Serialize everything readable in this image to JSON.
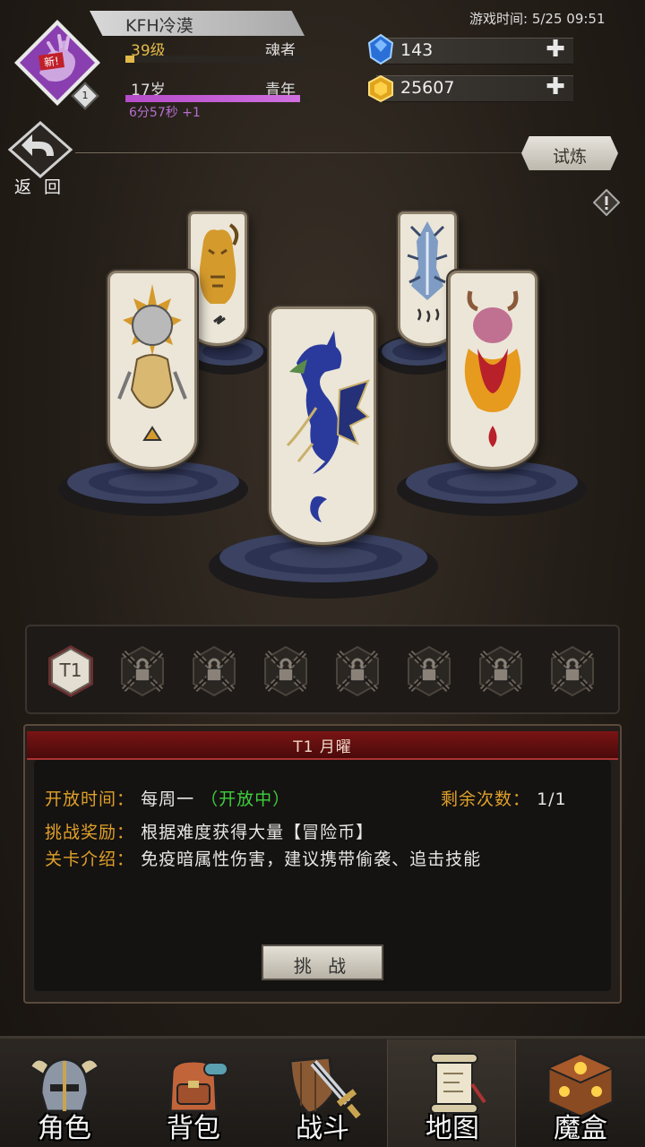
{
  "status": {
    "game_time": "游戏时间: 5/25 09:51"
  },
  "player": {
    "new_tag": "新!",
    "vip_level": "1",
    "name": "KFH冷漠",
    "level": "39级",
    "title": "魂者",
    "level_progress": 0.05,
    "age": "17岁",
    "stage": "青年",
    "age_progress": 0.95,
    "timer": "6分57秒 +1",
    "emblem_color": "#8a3fb0"
  },
  "currency": {
    "gems": "143",
    "gold": "25607",
    "gem_icon": "blue-crystal-icon",
    "gold_icon": "gold-coin-icon"
  },
  "nav_top": {
    "back_label": "返 回",
    "trial_label": "试炼"
  },
  "banners": [
    {
      "name": "spiked-beast",
      "symbol": "triangle"
    },
    {
      "name": "lynx",
      "symbol": "lightning"
    },
    {
      "name": "dragon",
      "symbol": "moon"
    },
    {
      "name": "frost-wyrm",
      "symbol": "wind"
    },
    {
      "name": "fire-demon",
      "symbol": "flame"
    }
  ],
  "tiers": {
    "current": "T1",
    "locked_count": 7
  },
  "info": {
    "header": "T1 月曜",
    "open_label": "开放时间：",
    "open_value": "每周一",
    "open_status": "（开放中）",
    "remain_label": "剩余次数：",
    "remain_value": "1/1",
    "reward_label": "挑战奖励：",
    "reward_value": "根据难度获得大量【冒险币】",
    "intro_label": "关卡介绍：",
    "intro_value": "免疫暗属性伤害，建议携带偷袭、追击技能",
    "challenge_label": "挑 战"
  },
  "bottom_nav": [
    {
      "label": "角色",
      "icon": "helmet-icon"
    },
    {
      "label": "背包",
      "icon": "backpack-icon"
    },
    {
      "label": "战斗",
      "icon": "sword-shield-icon"
    },
    {
      "label": "地图",
      "icon": "scroll-map-icon",
      "active": true
    },
    {
      "label": "魔盒",
      "icon": "magic-box-icon"
    }
  ]
}
